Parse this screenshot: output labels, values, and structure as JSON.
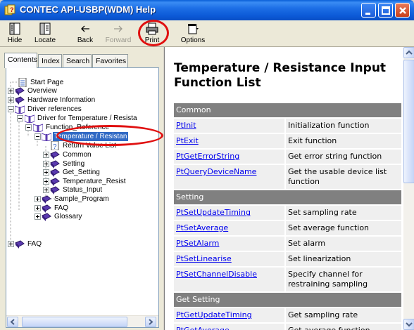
{
  "window": {
    "title": "CONTEC API-USBP(WDM) Help"
  },
  "toolbar": {
    "hide": "Hide",
    "locate": "Locate",
    "back": "Back",
    "forward": "Forward",
    "print": "Print",
    "options": "Options"
  },
  "tabs": [
    "Contents",
    "Index",
    "Search",
    "Favorites"
  ],
  "tree": {
    "start_page": "Start Page",
    "overview": "Overview",
    "hardware": "Hardware Information",
    "driver_refs": "Driver references",
    "driver_temp": "Driver for Temperature / Resista",
    "function_ref": "Function_Reference",
    "temp_res": "Temperature / Resistan",
    "return_value": "Return Value List",
    "common": "Common",
    "setting": "Setting",
    "get_setting": "Get_Setting",
    "temp_resist": "Temperature_Resist",
    "status_input": "Status_Input",
    "sample_program": "Sample_Program",
    "faq_inner": "FAQ",
    "glossary": "Glossary",
    "faq": "FAQ"
  },
  "content": {
    "title": "Temperature / Resistance Input Function List",
    "rows": [
      {
        "type": "header",
        "label": "Common"
      },
      {
        "type": "func",
        "name": "PtInit",
        "desc": "Initialization function"
      },
      {
        "type": "func",
        "name": "PtExit",
        "desc": "Exit function"
      },
      {
        "type": "func",
        "name": "PtGetErrorString",
        "desc": "Get error string function"
      },
      {
        "type": "func",
        "name": "PtQueryDeviceName",
        "desc": "Get the usable device list function"
      },
      {
        "type": "header",
        "label": "Setting"
      },
      {
        "type": "func",
        "name": "PtSetUpdateTiming",
        "desc": "Set sampling rate"
      },
      {
        "type": "func",
        "name": "PtSetAverage",
        "desc": "Set average function"
      },
      {
        "type": "func",
        "name": "PtSetAlarm",
        "desc": "Set alarm"
      },
      {
        "type": "func",
        "name": "PtSetLinearise",
        "desc": "Set linearization"
      },
      {
        "type": "func",
        "name": "PtSetChannelDisable",
        "desc": "Specify channel for restraining sampling"
      },
      {
        "type": "header",
        "label": "Get Setting"
      },
      {
        "type": "func",
        "name": "PtGetUpdateTiming",
        "desc": "Get sampling rate"
      },
      {
        "type": "func",
        "name": "PtGetAverage",
        "desc": "Get average function"
      }
    ]
  }
}
